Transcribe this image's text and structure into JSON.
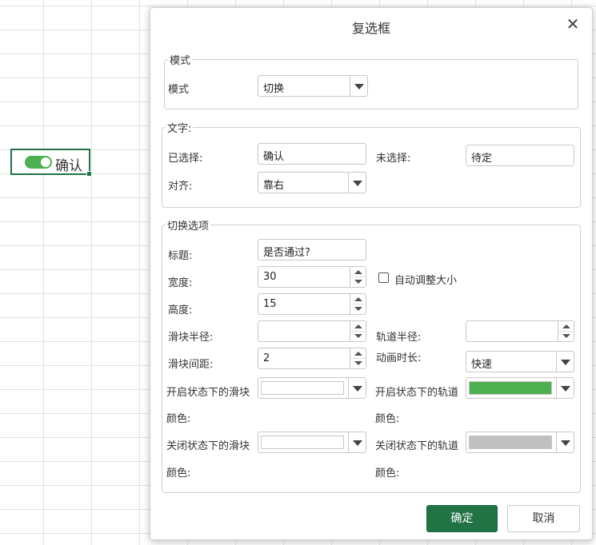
{
  "cell": {
    "text": "确认"
  },
  "dialog": {
    "title": "复选框",
    "close_icon": "close-icon"
  },
  "mode_group": {
    "legend": "模式",
    "mode_label": "模式",
    "mode_value": "切换"
  },
  "text_group": {
    "legend": "文字:",
    "selected_label": "已选择:",
    "selected_value": "确认",
    "unselected_label": "未选择:",
    "unselected_value": "待定",
    "align_label": "对齐:",
    "align_value": "靠右"
  },
  "toggle_group": {
    "legend": "切换选项",
    "caption_label": "标题:",
    "caption_value": "是否通过?",
    "width_label": "宽度:",
    "width_value": "30",
    "auto_size_label": "自动调整大小",
    "auto_size_checked": false,
    "height_label": "高度:",
    "height_value": "15",
    "slider_radius_label": "滑块半径:",
    "slider_radius_value": "",
    "track_radius_label": "轨道半径:",
    "track_radius_value": "",
    "slider_gap_label": "滑块间距:",
    "slider_gap_value": "2",
    "anim_duration_label": "动画时长:",
    "anim_duration_value": "快速",
    "on_slider_color_label_1": "开启状态下的滑块",
    "on_slider_color_label_2": "颜色:",
    "on_slider_color": "#ffffff",
    "on_track_color_label_1": "开启状态下的轨道",
    "on_track_color_label_2": "颜色:",
    "on_track_color": "#4caf50",
    "off_slider_color_label_1": "关闭状态下的滑块",
    "off_slider_color_label_2": "颜色:",
    "off_slider_color": "#ffffff",
    "off_track_color_label_1": "关闭状态下的轨道",
    "off_track_color_label_2": "颜色:",
    "off_track_color": "#c0c0c0"
  },
  "buttons": {
    "ok": "确定",
    "cancel": "取消"
  },
  "colors": {
    "accent": "#217346",
    "toggle_on": "#4caf50"
  }
}
